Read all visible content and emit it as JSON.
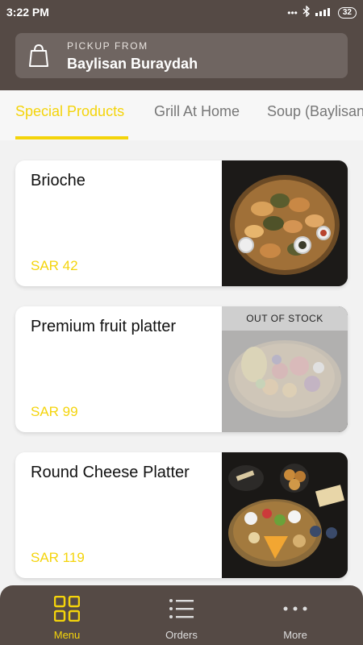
{
  "status_bar": {
    "time": "3:22 PM",
    "battery": "32"
  },
  "pickup": {
    "label": "PICKUP FROM",
    "location": "Baylisan Buraydah"
  },
  "tabs": [
    {
      "label": "Special Products"
    },
    {
      "label": "Grill At Home"
    },
    {
      "label": "Soup (Baylisan"
    }
  ],
  "products": [
    {
      "name": "Brioche",
      "price": "SAR 42"
    },
    {
      "name": "Premium fruit platter",
      "price": "SAR 99",
      "badge": "OUT OF STOCK"
    },
    {
      "name": "Round Cheese Platter",
      "price": "SAR 119"
    }
  ],
  "nav": [
    {
      "label": "Menu",
      "icon": "grid-icon"
    },
    {
      "label": "Orders",
      "icon": "list-icon"
    },
    {
      "label": "More",
      "icon": "more-dots-icon"
    }
  ],
  "colors": {
    "brand": "#554a45",
    "accent": "#f4d40b"
  }
}
